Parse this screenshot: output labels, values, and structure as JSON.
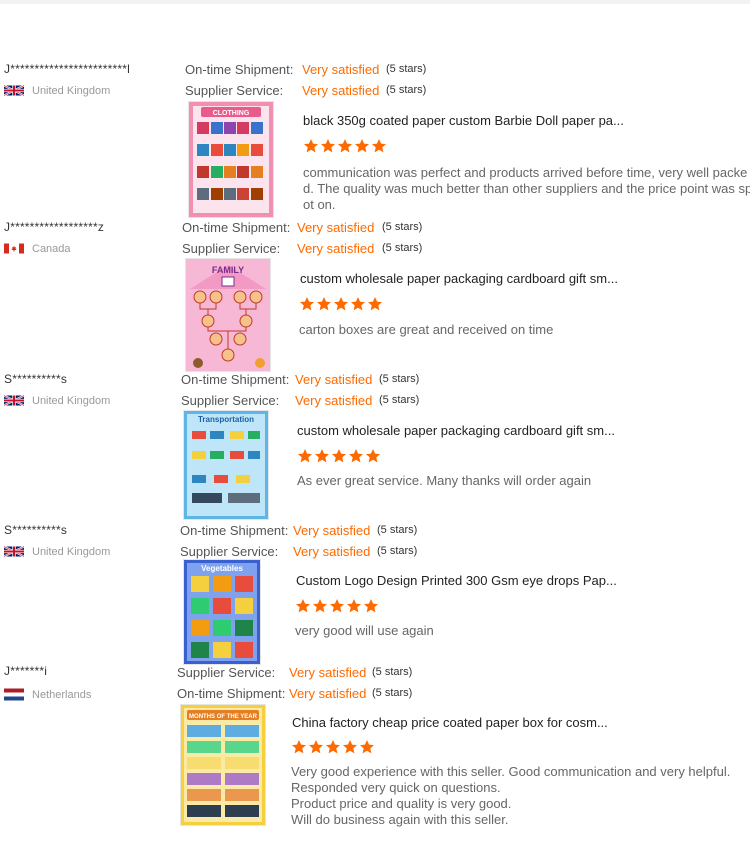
{
  "colors": {
    "accent": "#ff6a00",
    "star": "#ff6a00"
  },
  "reviews": [
    {
      "buyer": "J************************l",
      "country": "United Kingdom",
      "flag_icon": "uk-flag-icon",
      "row1_label": "On-time Shipment:",
      "row1_value": "Very satisfied",
      "row1_stars": "(5 stars)",
      "row2_label": "Supplier Service:",
      "row2_value": "Very satisfied",
      "row2_stars": "(5 stars)",
      "thumb_title": "CLOTHING",
      "product": "black 350g coated paper custom Barbie Doll paper pa...",
      "rating": 5,
      "comment": [
        "communication was perfect and products arrived before time, very well packe",
        "d. The quality was much better than other suppliers and the price point was sp",
        "ot on."
      ]
    },
    {
      "buyer": "J******************z",
      "country": "Canada",
      "flag_icon": "canada-flag-icon",
      "row1_label": "On-time Shipment:",
      "row1_value": "Very satisfied",
      "row1_stars": "(5 stars)",
      "row2_label": "Supplier Service:",
      "row2_value": "Very satisfied",
      "row2_stars": "(5 stars)",
      "thumb_title": "FAMILY",
      "product": "custom wholesale paper packaging cardboard gift sm...",
      "rating": 5,
      "comment": [
        "carton boxes are great and received on time"
      ]
    },
    {
      "buyer": "S**********s",
      "country": "United Kingdom",
      "flag_icon": "uk-flag-icon",
      "row1_label": "On-time Shipment:",
      "row1_value": "Very satisfied",
      "row1_stars": "(5 stars)",
      "row2_label": "Supplier Service:",
      "row2_value": "Very satisfied",
      "row2_stars": "(5 stars)",
      "thumb_title": "Transportation",
      "product": "custom wholesale paper packaging cardboard gift sm...",
      "rating": 5,
      "comment": [
        "As ever great service. Many thanks will order again"
      ]
    },
    {
      "buyer": "S**********s",
      "country": "United Kingdom",
      "flag_icon": "uk-flag-icon",
      "row1_label": "On-time Shipment:",
      "row1_value": "Very satisfied",
      "row1_stars": "(5 stars)",
      "row2_label": "Supplier Service:",
      "row2_value": "Very satisfied",
      "row2_stars": "(5 stars)",
      "thumb_title": "Vegetables",
      "product": "Custom Logo Design Printed 300 Gsm eye drops Pap...",
      "rating": 5,
      "comment": [
        "very good will use again"
      ]
    },
    {
      "buyer": "J*******i",
      "country": "Netherlands",
      "flag_icon": "netherlands-flag-icon",
      "row1_label": "Supplier Service:",
      "row1_value": "Very satisfied",
      "row1_stars": "(5 stars)",
      "row2_label": "On-time Shipment:",
      "row2_value": "Very satisfied",
      "row2_stars": "(5 stars)",
      "thumb_title": "MONTHS OF THE YEAR",
      "product": "China factory cheap price coated paper box for cosm...",
      "rating": 5,
      "comment": [
        "Very good experience with this seller. Good communication and very helpful.",
        "Responded very quick on questions.",
        "Product price and quality is very good.",
        "Will do business again with this seller."
      ]
    }
  ]
}
